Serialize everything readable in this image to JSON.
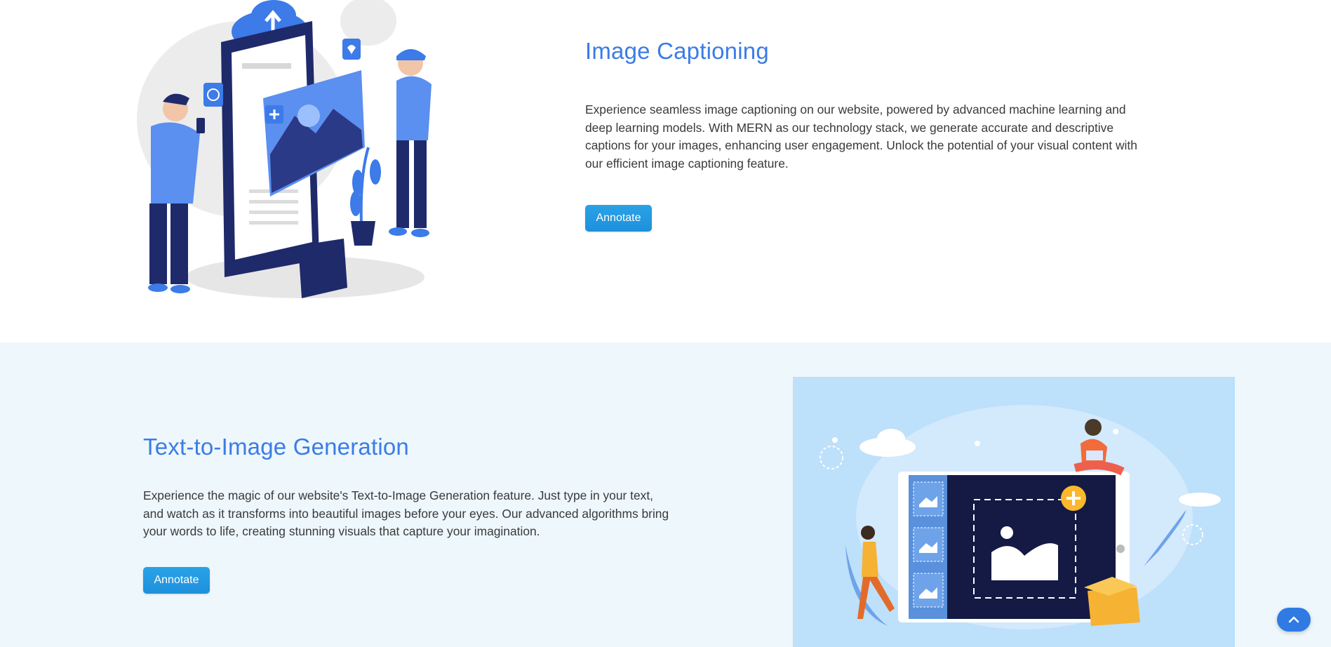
{
  "sections": [
    {
      "title": "Image Captioning",
      "description": "Experience seamless image captioning on our website, powered by advanced machine learning and deep learning models. With MERN as our technology stack, we generate accurate and descriptive captions for your images, enhancing user engagement. Unlock the potential of your visual content with our efficient image captioning feature.",
      "button_label": "Annotate"
    },
    {
      "title": "Text-to-Image Generation",
      "description": "Experience the magic of our website's Text-to-Image Generation feature. Just type in your text, and watch as it transforms into beautiful images before your eyes. Our advanced algorithms bring your words to life, creating stunning visuals that capture your imagination.",
      "button_label": "Annotate"
    }
  ],
  "scroll_top_icon": "chevron-up-icon",
  "colors": {
    "title": "#3b7ce6",
    "button": "#1e90dc",
    "section_alt_bg": "#eef7fc",
    "illustration_bg": "#bde0fb",
    "scroll_top": "#2f7ae3"
  }
}
